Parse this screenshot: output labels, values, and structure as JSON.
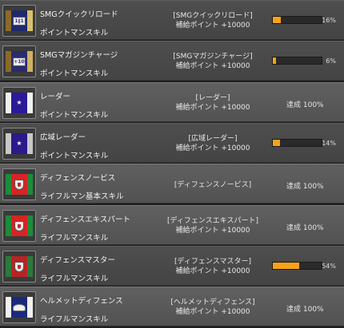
{
  "colors": {
    "progress_fill": "#f7a21b",
    "row_bg": "#5a5a5a"
  },
  "skills": [
    {
      "name": "SMGクイックリロード",
      "type": "ポイントマンスキル",
      "bracket": "[SMGクイックリロード]",
      "points": "補給ポイント +10000",
      "progress": 16,
      "progress_label": "16%",
      "status": null,
      "ribbon_colors": [
        "#8a6a2a",
        "#1e2a6e",
        "#d8c070"
      ],
      "emblem": "plate",
      "emblem_text": "1∥1"
    },
    {
      "name": "SMGマガジンチャージ",
      "type": "ポイントマンスキル",
      "bracket": "[SMGマガジンチャージ]",
      "points": "補給ポイント +10000",
      "progress": 6,
      "progress_label": "6%",
      "status": null,
      "ribbon_colors": [
        "#8a6a2a",
        "#2a2a6e",
        "#d0b060"
      ],
      "emblem": "plate",
      "emblem_text": "+10"
    },
    {
      "name": "レーダー",
      "type": "ポイントマンスキル",
      "bracket": "[レーダー]",
      "points": "補給ポイント +10000",
      "progress": 100,
      "progress_label": null,
      "status": "達成 100%",
      "ribbon_colors": [
        "#f0f0f0",
        "#2a1a9a",
        "#f0f0f0"
      ],
      "emblem": "star",
      "emblem_text": ""
    },
    {
      "name": "広域レーダー",
      "type": "ポイントマンスキル",
      "bracket": "[広域レーダー]",
      "points": "補給ポイント +10000",
      "progress": 14,
      "progress_label": "14%",
      "status": null,
      "ribbon_colors": [
        "#c8c8c8",
        "#2a1a8a",
        "#c8c8c8"
      ],
      "emblem": "star",
      "emblem_text": ""
    },
    {
      "name": "ディフェンスノービス",
      "type": "ライフルマン基本スキル",
      "bracket": "[ディフェンスノービス]",
      "points": "",
      "progress": 100,
      "progress_label": null,
      "status": "達成 100%",
      "ribbon_colors": [
        "#1f8a3a",
        "#d82424",
        "#1f8a3a"
      ],
      "emblem": "shield",
      "emblem_text": ""
    },
    {
      "name": "ディフェンスエキスパート",
      "type": "ライフルマンスキル",
      "bracket": "[ディフェンスエキスパート]",
      "points": "補給ポイント +10000",
      "progress": 100,
      "progress_label": null,
      "status": "達成 100%",
      "ribbon_colors": [
        "#1f8a3a",
        "#d82424",
        "#1f8a3a"
      ],
      "emblem": "shield",
      "emblem_text": ""
    },
    {
      "name": "ディフェンスマスター",
      "type": "ライフルマンスキル",
      "bracket": "[ディフェンスマスター]",
      "points": "補給ポイント +10000",
      "progress": 54,
      "progress_label": "54%",
      "status": null,
      "ribbon_colors": [
        "#2a7a3a",
        "#b82424",
        "#2a7a3a"
      ],
      "emblem": "shield",
      "emblem_text": ""
    },
    {
      "name": "ヘルメットディフェンス",
      "type": "ライフルマンスキル",
      "bracket": "[ヘルメットディフェンス]",
      "points": "補給ポイント +10000",
      "progress": 100,
      "progress_label": null,
      "status": "達成 100%",
      "ribbon_colors": [
        "#f0f0f0",
        "#1a2a7a",
        "#f0f0f0"
      ],
      "emblem": "wings",
      "emblem_text": ""
    }
  ]
}
